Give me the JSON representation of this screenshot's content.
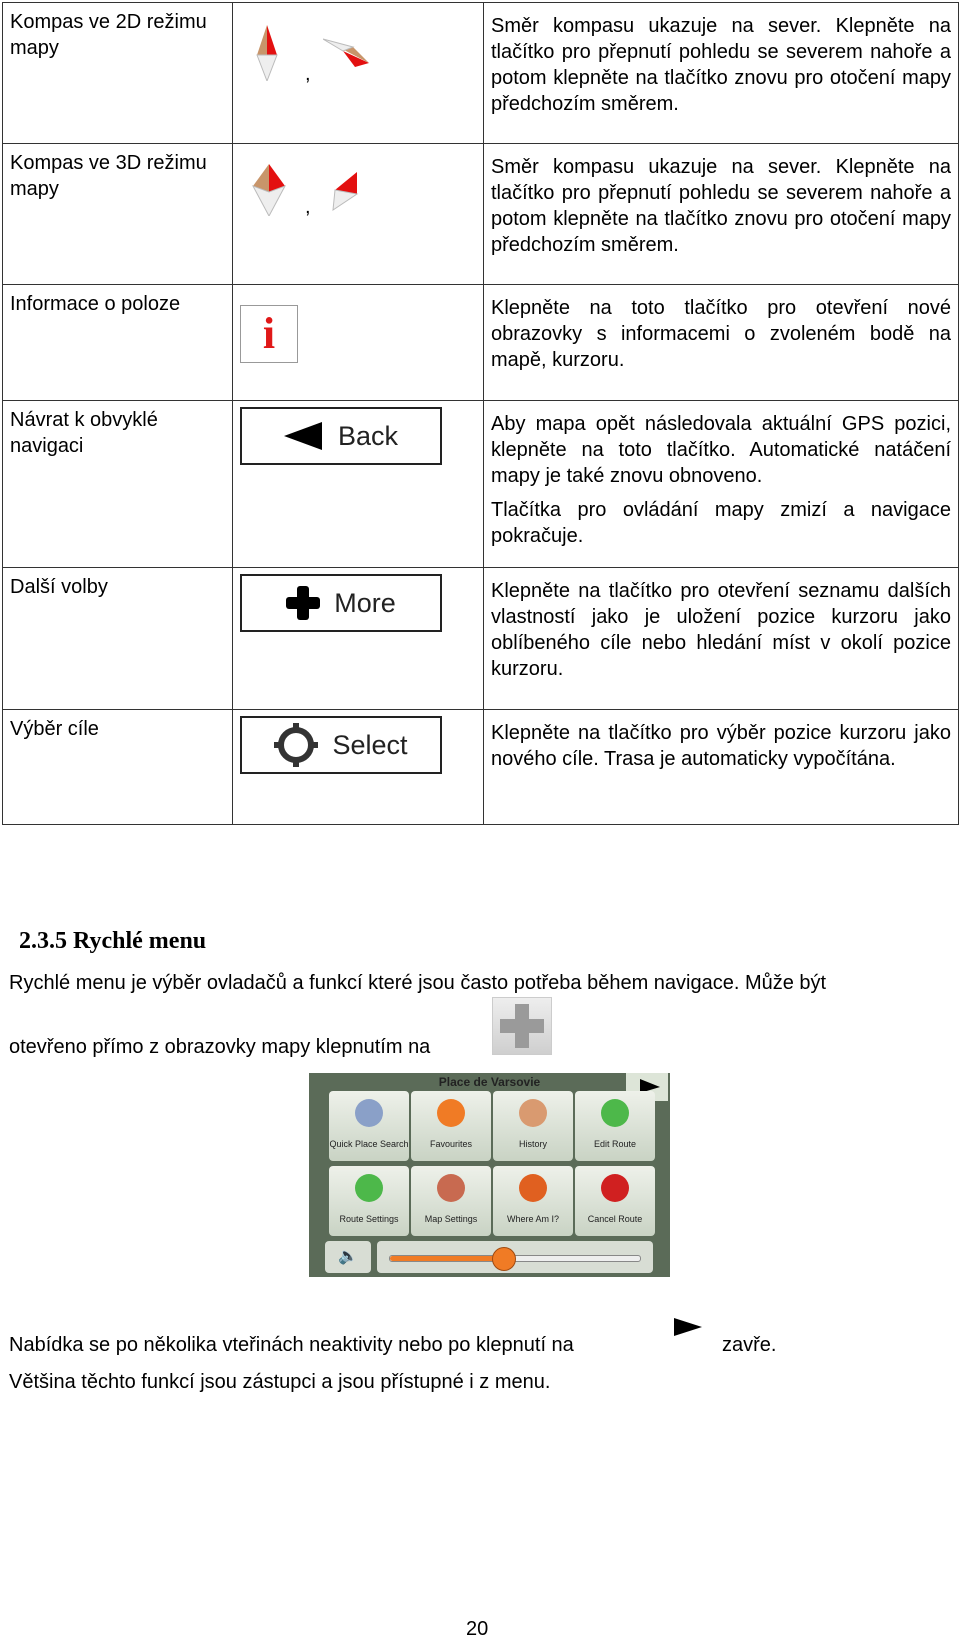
{
  "table": {
    "rows": [
      {
        "name": "Kompas ve 2D režimu mapy",
        "icon": "compass-2d-icon",
        "separator": ",",
        "desc": [
          "Směr kompasu ukazuje na sever. Klepněte na tlačítko pro přepnutí pohledu se severem nahoře a potom klepněte na tlačítko znovu pro otočení mapy předchozím směrem."
        ]
      },
      {
        "name": "Kompas ve 3D režimu mapy",
        "icon": "compass-3d-icon",
        "separator": ",",
        "desc": [
          "Směr kompasu ukazuje na sever. Klepněte na tlačítko pro přepnutí pohledu se severem nahoře a potom klepněte na tlačítko znovu pro otočení mapy předchozím směrem."
        ]
      },
      {
        "name": "Informace o poloze",
        "icon": "info-icon",
        "desc": [
          "Klepněte na toto tlačítko pro otevření nové obrazovky s informacemi o zvoleném bodě na mapě, kurzoru."
        ]
      },
      {
        "name": "Návrat k obvyklé navigaci",
        "icon": "back-arrow-icon",
        "button": "Back",
        "desc": [
          "Aby mapa opět následovala aktuální GPS pozici, klepněte na toto tlačítko. Automatické natáčení mapy je také znovu obnoveno.",
          "Tlačítka pro ovládání mapy zmizí a navigace pokračuje."
        ]
      },
      {
        "name": "Další volby",
        "icon": "plus-icon",
        "button": "More",
        "desc": [
          "Klepněte na tlačítko pro otevření seznamu dalších vlastností jako je uložení pozice kurzoru jako oblíbeného cíle nebo hledání míst v okolí pozice kurzoru."
        ]
      },
      {
        "name": "Výběr cíle",
        "icon": "crosshair-icon",
        "button": "Select",
        "desc": [
          "Klepněte na tlačítko pro výběr pozice kurzoru jako nového cíle. Trasa je automaticky vypočítána."
        ]
      }
    ]
  },
  "section": {
    "heading": "2.3.5 Rychlé menu",
    "line1": "Rychlé menu je výběr ovladačů a funkcí které jsou často potřeba během navigace. Může být",
    "line2": "otevřeno přímo z obrazovky mapy klepnutím na",
    "line2_end": ".",
    "line3": "Nabídka se po několika vteřinách neaktivity nebo po klepnutí na",
    "line3_end": "zavře.",
    "line4": "Většina těchto funkcí jsou zástupci a jsou přístupné i z menu."
  },
  "quick_menu": {
    "title": "Place de Varsovie",
    "tiles": [
      "Quick Place Search",
      "Favourites",
      "History",
      "Edit Route",
      "Route Settings",
      "Map Settings",
      "Where Am I?",
      "Cancel Route"
    ],
    "volume_percent": 45,
    "accent": "#f07b25"
  },
  "page_number": "20"
}
